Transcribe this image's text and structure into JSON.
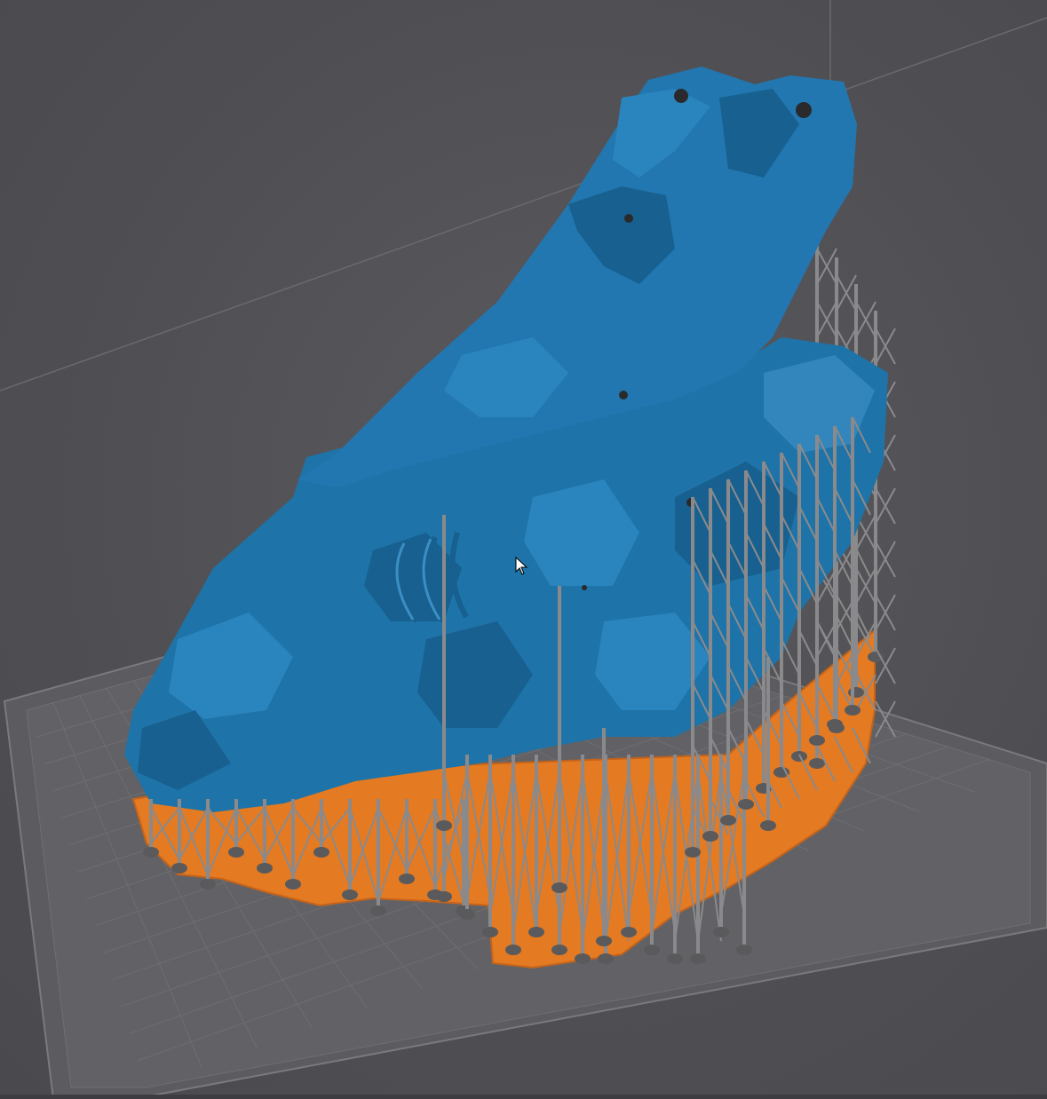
{
  "colors": {
    "background": "#505054",
    "model": "#1e73a8",
    "model_shadow": "#145680",
    "model_highlight": "#3a8fc4",
    "raft": "#e47a22",
    "supports": "#8a8a8c",
    "build_plate": "#5f5f63",
    "grid_line": "#767679"
  },
  "viewport": {
    "description_icon": "3d-viewport",
    "cursor_icon": "arrow-cursor-icon"
  }
}
